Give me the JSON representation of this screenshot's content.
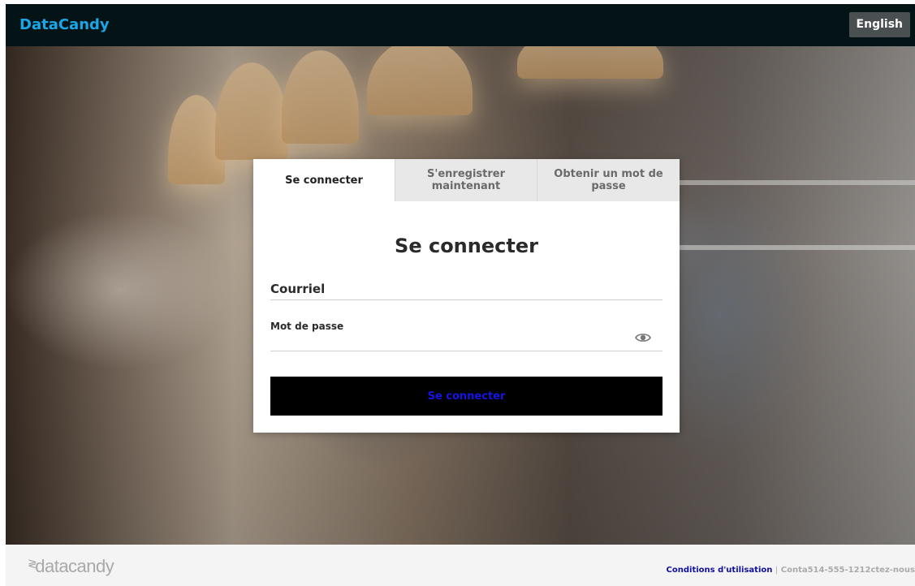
{
  "header": {
    "brand": "DataCandy",
    "language_button": "English"
  },
  "login_card": {
    "tabs": [
      {
        "label": "Se connecter",
        "active": true
      },
      {
        "label": "S'enregistrer maintenant",
        "active": false
      },
      {
        "label": "Obtenir un mot de passe",
        "active": false
      }
    ],
    "title": "Se connecter",
    "email_label": "Courriel",
    "password_label": "Mot de passe",
    "submit_label": "Se connecter"
  },
  "footer": {
    "logo": "datacandy",
    "terms_link": "Conditions d'utilisation",
    "separator": "|",
    "contact_text": "Conta514-555-1212ctez-nous"
  },
  "colors": {
    "topbar": "#041416",
    "brand": "#1aa6e8",
    "submit_bg": "#000000",
    "submit_text": "#1414e6",
    "terms_link": "#1010a0"
  },
  "icons": {
    "password_toggle": "eye-icon"
  }
}
